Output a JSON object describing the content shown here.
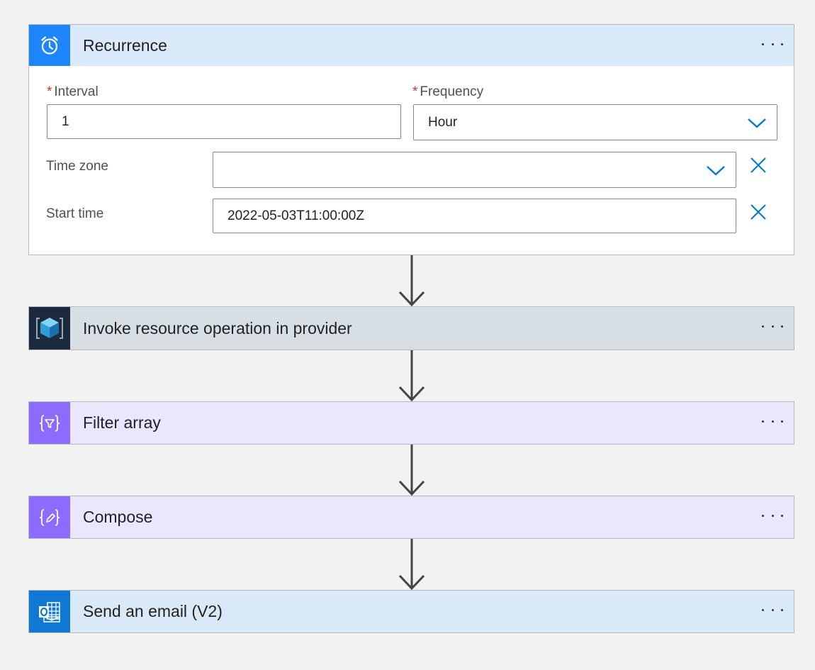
{
  "recurrence": {
    "title": "Recurrence",
    "icon": "alarm-clock-icon",
    "header_color": "#dbeafb",
    "icon_bg": "#1f85ff",
    "interval_label": "Interval",
    "interval_value": "1",
    "frequency_label": "Frequency",
    "frequency_value": "Hour",
    "timezone_label": "Time zone",
    "timezone_value": "",
    "starttime_label": "Start time",
    "starttime_value": "2022-05-03T11:00:00Z",
    "required_marker": "*"
  },
  "steps": [
    {
      "title": "Invoke resource operation in provider",
      "icon": "azure-cube-icon",
      "header_color": "#d8dfe4",
      "icon_bg": "#1b2a3d"
    },
    {
      "title": "Filter array",
      "icon": "filter-array-icon",
      "header_color": "#ebe5fd",
      "icon_bg": "#8c6cff"
    },
    {
      "title": "Compose",
      "icon": "compose-icon",
      "header_color": "#ebe5fd",
      "icon_bg": "#8c6cff"
    },
    {
      "title": "Send an email (V2)",
      "icon": "outlook-icon",
      "header_color": "#d9e9f7",
      "icon_bg": "#0f78d4"
    }
  ],
  "accent_color": "#0078d4"
}
